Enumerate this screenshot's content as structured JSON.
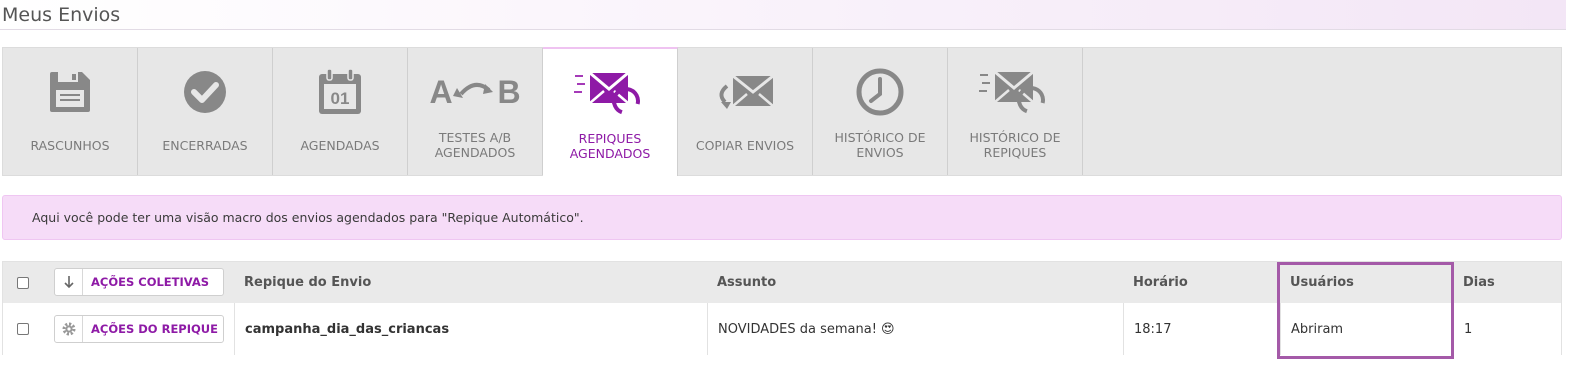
{
  "page": {
    "title": "Meus Envios"
  },
  "tabs": [
    {
      "label": "RASCUNHOS",
      "icon": "save-icon",
      "active": false
    },
    {
      "label": "ENCERRADAS",
      "icon": "check-circle-icon",
      "active": false
    },
    {
      "label": "AGENDADAS",
      "icon": "calendar-icon",
      "active": false,
      "icon_text": "01"
    },
    {
      "label": "TESTES A/B",
      "label2": "AGENDADOS",
      "icon": "ab-test-icon",
      "active": false,
      "icon_text_a": "A",
      "icon_text_b": "B"
    },
    {
      "label": "REPIQUES",
      "label2": "AGENDADOS",
      "icon": "repique-envelope-icon",
      "active": true
    },
    {
      "label": "COPIAR ENVIOS",
      "icon": "copy-envelope-icon",
      "active": false
    },
    {
      "label": "HISTÓRICO DE",
      "label2": "ENVIOS",
      "icon": "clock-icon",
      "active": false
    },
    {
      "label": "HISTÓRICO DE",
      "label2": "REPIQUES",
      "icon": "repique-history-icon",
      "active": false
    }
  ],
  "info": {
    "text": "Aqui você pode ter uma visão macro dos envios agendados para \"Repique Automático\"."
  },
  "table": {
    "bulk_actions_label": "AÇÕES COLETIVAS",
    "columns": [
      "Repique do Envio",
      "Assunto",
      "Horário",
      "Usuários",
      "Dias"
    ],
    "rows": [
      {
        "actions_label": "AÇÕES DO REPIQUE",
        "envio": "campanha_dia_das_criancas",
        "assunto": "NOVIDADES da semana! 😍",
        "horario": "18:17",
        "usuarios": "Abriram",
        "dias": "1"
      }
    ]
  },
  "colors": {
    "accent": "#8e1aa6",
    "highlight": "#a45aa8",
    "info_bg": "#f6dcf8"
  }
}
